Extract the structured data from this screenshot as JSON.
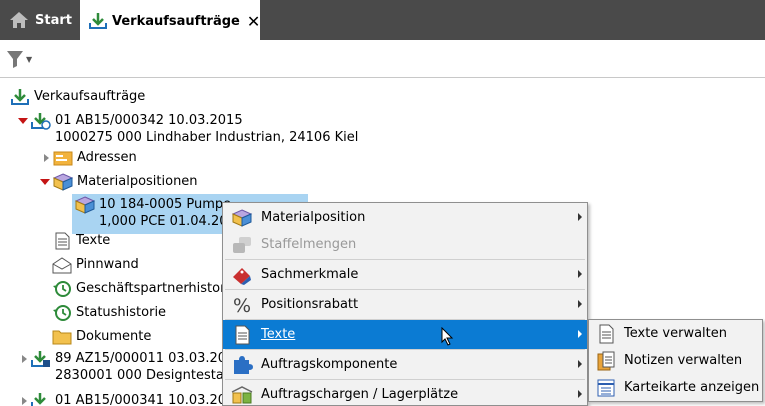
{
  "tabs": {
    "start_label": "Start",
    "active_label": "Verkaufsaufträge",
    "close_glyph": "✕"
  },
  "tree": {
    "root_label": "Verkaufsaufträge",
    "order1_line1": "01 AB15/000342 10.03.2015",
    "order1_line2": "1000275 000 Lindhaber Industrian, 24106 Kiel",
    "adressen": "Adressen",
    "materialpositionen": "Materialpositionen",
    "pos_line1": "10 184-0005 Pumpe",
    "pos_line2": "1,000 PCE 01.04.20",
    "texte": "Texte",
    "pinnwand": "Pinnwand",
    "geschaeftspartner": "Geschäftspartnerhistor",
    "statushistorie": "Statushistorie",
    "dokumente": "Dokumente",
    "order2_line1": "89 AZ15/000011 03.03.20",
    "order2_line2": "2830001 000 Designtesta",
    "order3_line1": "01 AB15/000341 10.03.20"
  },
  "context_menu": {
    "items": [
      {
        "label": "Materialposition",
        "icon": "material-position-icon"
      },
      {
        "label": "Staffelmengen",
        "icon": "staffel-icon"
      },
      {
        "label": "Sachmerkmale",
        "icon": "tag-icon"
      },
      {
        "label": "Positionsrabatt",
        "icon": "percent-icon"
      },
      {
        "label": "Texte",
        "icon": "document-icon"
      },
      {
        "label": "Auftragskomponente",
        "icon": "puzzle-icon"
      },
      {
        "label": "Auftragschargen / Lagerplätze",
        "icon": "warehouse-icon"
      }
    ]
  },
  "submenu": {
    "items": [
      {
        "label": "Texte verwalten",
        "icon": "document-icon"
      },
      {
        "label": "Notizen verwalten",
        "icon": "notes-icon"
      },
      {
        "label": "Karteikarte anzeigen",
        "icon": "card-icon"
      }
    ]
  },
  "colors": {
    "tab_bar": "#4a4a4a",
    "highlight": "#0b7bd3",
    "selection": "#a9d4f2",
    "download_green": "#2e8b3a"
  }
}
